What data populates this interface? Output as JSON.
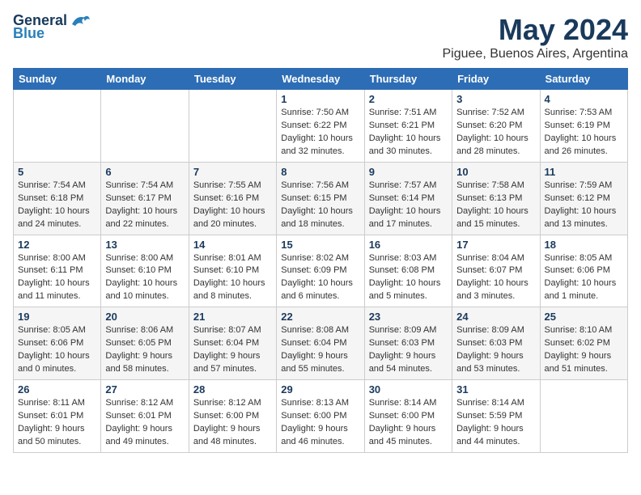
{
  "logo": {
    "line1": "General",
    "line2": "Blue"
  },
  "title": "May 2024",
  "location": "Piguee, Buenos Aires, Argentina",
  "days_of_week": [
    "Sunday",
    "Monday",
    "Tuesday",
    "Wednesday",
    "Thursday",
    "Friday",
    "Saturday"
  ],
  "weeks": [
    [
      {
        "day": "",
        "info": ""
      },
      {
        "day": "",
        "info": ""
      },
      {
        "day": "",
        "info": ""
      },
      {
        "day": "1",
        "info": "Sunrise: 7:50 AM\nSunset: 6:22 PM\nDaylight: 10 hours\nand 32 minutes."
      },
      {
        "day": "2",
        "info": "Sunrise: 7:51 AM\nSunset: 6:21 PM\nDaylight: 10 hours\nand 30 minutes."
      },
      {
        "day": "3",
        "info": "Sunrise: 7:52 AM\nSunset: 6:20 PM\nDaylight: 10 hours\nand 28 minutes."
      },
      {
        "day": "4",
        "info": "Sunrise: 7:53 AM\nSunset: 6:19 PM\nDaylight: 10 hours\nand 26 minutes."
      }
    ],
    [
      {
        "day": "5",
        "info": "Sunrise: 7:54 AM\nSunset: 6:18 PM\nDaylight: 10 hours\nand 24 minutes."
      },
      {
        "day": "6",
        "info": "Sunrise: 7:54 AM\nSunset: 6:17 PM\nDaylight: 10 hours\nand 22 minutes."
      },
      {
        "day": "7",
        "info": "Sunrise: 7:55 AM\nSunset: 6:16 PM\nDaylight: 10 hours\nand 20 minutes."
      },
      {
        "day": "8",
        "info": "Sunrise: 7:56 AM\nSunset: 6:15 PM\nDaylight: 10 hours\nand 18 minutes."
      },
      {
        "day": "9",
        "info": "Sunrise: 7:57 AM\nSunset: 6:14 PM\nDaylight: 10 hours\nand 17 minutes."
      },
      {
        "day": "10",
        "info": "Sunrise: 7:58 AM\nSunset: 6:13 PM\nDaylight: 10 hours\nand 15 minutes."
      },
      {
        "day": "11",
        "info": "Sunrise: 7:59 AM\nSunset: 6:12 PM\nDaylight: 10 hours\nand 13 minutes."
      }
    ],
    [
      {
        "day": "12",
        "info": "Sunrise: 8:00 AM\nSunset: 6:11 PM\nDaylight: 10 hours\nand 11 minutes."
      },
      {
        "day": "13",
        "info": "Sunrise: 8:00 AM\nSunset: 6:10 PM\nDaylight: 10 hours\nand 10 minutes."
      },
      {
        "day": "14",
        "info": "Sunrise: 8:01 AM\nSunset: 6:10 PM\nDaylight: 10 hours\nand 8 minutes."
      },
      {
        "day": "15",
        "info": "Sunrise: 8:02 AM\nSunset: 6:09 PM\nDaylight: 10 hours\nand 6 minutes."
      },
      {
        "day": "16",
        "info": "Sunrise: 8:03 AM\nSunset: 6:08 PM\nDaylight: 10 hours\nand 5 minutes."
      },
      {
        "day": "17",
        "info": "Sunrise: 8:04 AM\nSunset: 6:07 PM\nDaylight: 10 hours\nand 3 minutes."
      },
      {
        "day": "18",
        "info": "Sunrise: 8:05 AM\nSunset: 6:06 PM\nDaylight: 10 hours\nand 1 minute."
      }
    ],
    [
      {
        "day": "19",
        "info": "Sunrise: 8:05 AM\nSunset: 6:06 PM\nDaylight: 10 hours\nand 0 minutes."
      },
      {
        "day": "20",
        "info": "Sunrise: 8:06 AM\nSunset: 6:05 PM\nDaylight: 9 hours\nand 58 minutes."
      },
      {
        "day": "21",
        "info": "Sunrise: 8:07 AM\nSunset: 6:04 PM\nDaylight: 9 hours\nand 57 minutes."
      },
      {
        "day": "22",
        "info": "Sunrise: 8:08 AM\nSunset: 6:04 PM\nDaylight: 9 hours\nand 55 minutes."
      },
      {
        "day": "23",
        "info": "Sunrise: 8:09 AM\nSunset: 6:03 PM\nDaylight: 9 hours\nand 54 minutes."
      },
      {
        "day": "24",
        "info": "Sunrise: 8:09 AM\nSunset: 6:03 PM\nDaylight: 9 hours\nand 53 minutes."
      },
      {
        "day": "25",
        "info": "Sunrise: 8:10 AM\nSunset: 6:02 PM\nDaylight: 9 hours\nand 51 minutes."
      }
    ],
    [
      {
        "day": "26",
        "info": "Sunrise: 8:11 AM\nSunset: 6:01 PM\nDaylight: 9 hours\nand 50 minutes."
      },
      {
        "day": "27",
        "info": "Sunrise: 8:12 AM\nSunset: 6:01 PM\nDaylight: 9 hours\nand 49 minutes."
      },
      {
        "day": "28",
        "info": "Sunrise: 8:12 AM\nSunset: 6:00 PM\nDaylight: 9 hours\nand 48 minutes."
      },
      {
        "day": "29",
        "info": "Sunrise: 8:13 AM\nSunset: 6:00 PM\nDaylight: 9 hours\nand 46 minutes."
      },
      {
        "day": "30",
        "info": "Sunrise: 8:14 AM\nSunset: 6:00 PM\nDaylight: 9 hours\nand 45 minutes."
      },
      {
        "day": "31",
        "info": "Sunrise: 8:14 AM\nSunset: 5:59 PM\nDaylight: 9 hours\nand 44 minutes."
      },
      {
        "day": "",
        "info": ""
      }
    ]
  ]
}
